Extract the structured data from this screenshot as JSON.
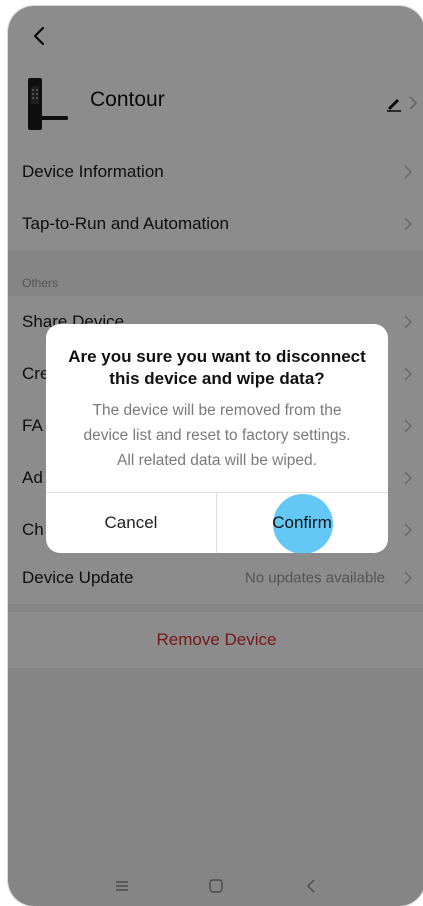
{
  "device": {
    "name": "Contour"
  },
  "rows_top": [
    {
      "label": "Device Information"
    },
    {
      "label": "Tap-to-Run and Automation"
    }
  ],
  "sections": {
    "others_label": "Others"
  },
  "rows_others": [
    {
      "label": "Share Device"
    },
    {
      "label": "Cre"
    },
    {
      "label": "FA"
    },
    {
      "label": "Ad"
    },
    {
      "label": "Ch"
    }
  ],
  "device_update": {
    "label": "Device Update",
    "value": "No updates available"
  },
  "remove_label": "Remove Device",
  "dialog": {
    "title_line1": "Are you sure you want to disconnect",
    "title_line2": "this device and wipe data?",
    "msg_line1": "The device will be removed from the",
    "msg_line2": "device list and reset to factory settings.",
    "msg_line3": "All related data will be wiped.",
    "cancel": "Cancel",
    "confirm": "Confirm"
  },
  "icons": {
    "back": "back-arrow-icon",
    "edit": "pencil-icon",
    "chevron": "chevron-right-icon",
    "nav_menu": "menu-icon",
    "nav_home": "home-icon",
    "nav_back": "back-icon"
  },
  "colors": {
    "danger": "#d0312d",
    "tap": "#48bef5"
  }
}
